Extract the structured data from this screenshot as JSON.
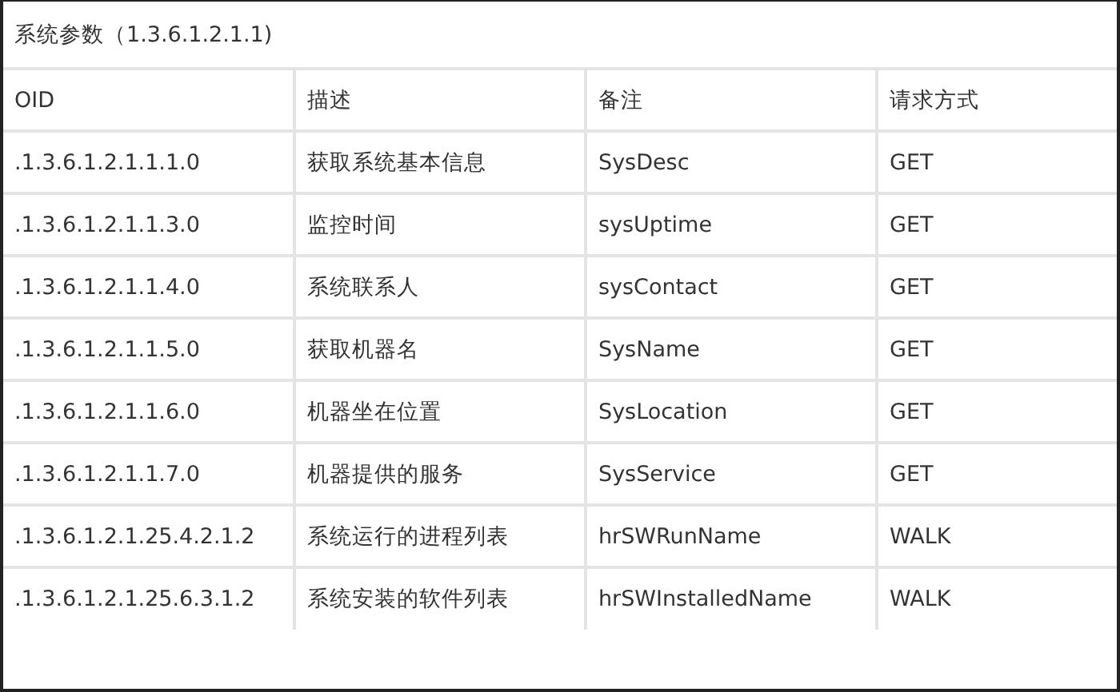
{
  "table": {
    "title": "系统参数（1.3.6.1.2.1.1)",
    "columns": [
      "OID",
      "描述",
      "备注",
      "请求方式"
    ],
    "rows": [
      [
        ".1.3.6.1.2.1.1.1.0",
        "获取系统基本信息",
        "SysDesc",
        "GET"
      ],
      [
        ".1.3.6.1.2.1.1.3.0",
        "监控时间",
        "sysUptime",
        "GET"
      ],
      [
        ".1.3.6.1.2.1.1.4.0",
        "系统联系人",
        "sysContact",
        "GET"
      ],
      [
        ".1.3.6.1.2.1.1.5.0",
        "获取机器名",
        "SysName",
        "GET"
      ],
      [
        ".1.3.6.1.2.1.1.6.0",
        "机器坐在位置",
        "SysLocation",
        "GET"
      ],
      [
        ".1.3.6.1.2.1.1.7.0",
        "机器提供的服务",
        "SysService",
        "GET"
      ],
      [
        ".1.3.6.1.2.1.25.4.2.1.2",
        "系统运行的进程列表",
        "hrSWRunName",
        "WALK"
      ],
      [
        ".1.3.6.1.2.1.25.6.3.1.2",
        "系统安装的软件列表",
        "hrSWInstalledName",
        "WALK"
      ]
    ]
  }
}
